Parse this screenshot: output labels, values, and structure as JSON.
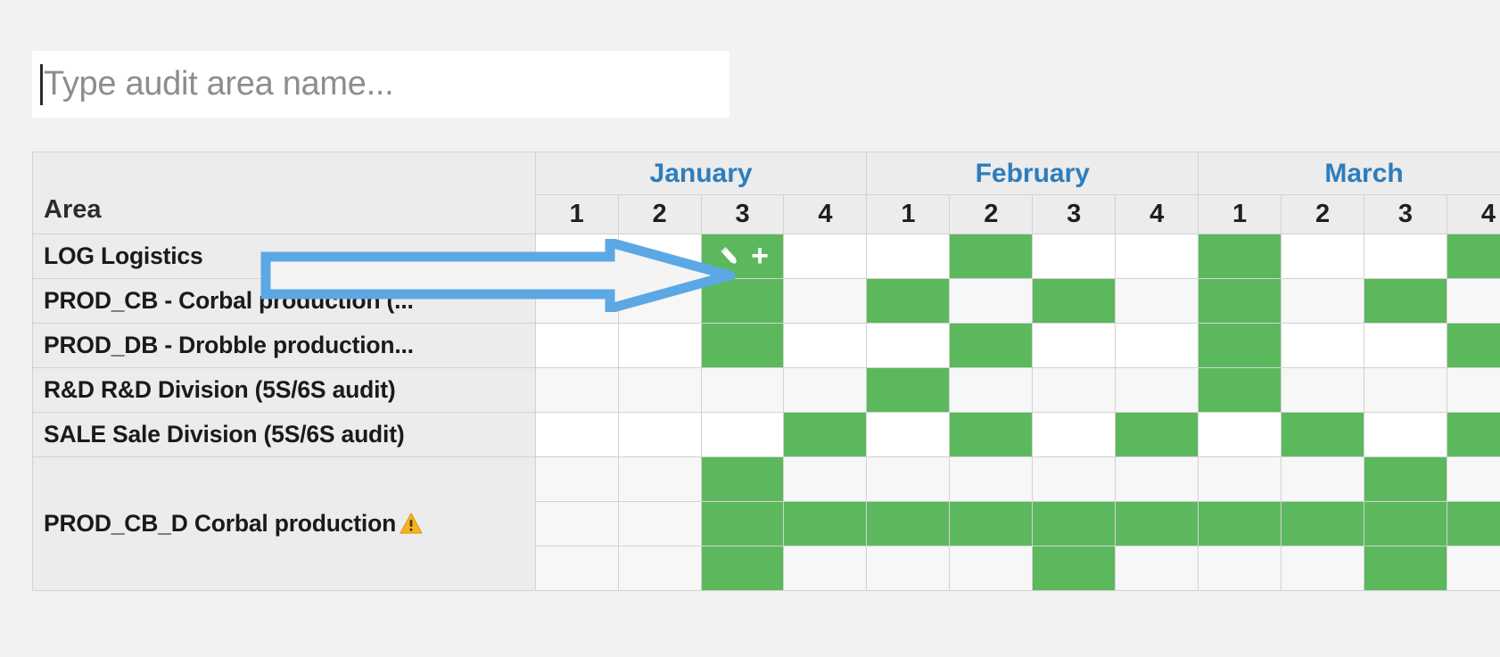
{
  "search": {
    "placeholder": "Type audit area name...",
    "value": ""
  },
  "colors": {
    "accent_green": "#5cb85c",
    "month_blue": "#2e7dbb",
    "arrow_blue": "#5ba8e5",
    "warning_amber": "#f5b324",
    "header_bg": "#ececec"
  },
  "table": {
    "area_header": "Area",
    "months": [
      {
        "name": "January",
        "weeks": [
          "1",
          "2",
          "3",
          "4"
        ]
      },
      {
        "name": "February",
        "weeks": [
          "1",
          "2",
          "3",
          "4"
        ]
      },
      {
        "name": "March",
        "weeks": [
          "1",
          "2",
          "3",
          "4"
        ]
      }
    ],
    "rows": [
      {
        "label": "LOG Logistics",
        "warning": false,
        "subrows": [
          {
            "cells": [
              0,
              0,
              1,
              0,
              0,
              1,
              0,
              0,
              1,
              0,
              0,
              1
            ],
            "icons_at": 2
          }
        ]
      },
      {
        "label": "PROD_CB - Corbal production (...",
        "warning": false,
        "subrows": [
          {
            "cells": [
              0,
              0,
              1,
              0,
              1,
              0,
              1,
              0,
              1,
              0,
              1,
              0
            ],
            "icons_at": -1
          }
        ]
      },
      {
        "label": "PROD_DB - Drobble production...",
        "warning": false,
        "subrows": [
          {
            "cells": [
              0,
              0,
              1,
              0,
              0,
              1,
              0,
              0,
              1,
              0,
              0,
              1
            ],
            "icons_at": -1
          }
        ]
      },
      {
        "label": "R&D R&D Division (5S/6S audit)",
        "warning": false,
        "subrows": [
          {
            "cells": [
              0,
              0,
              0,
              0,
              1,
              0,
              0,
              0,
              1,
              0,
              0,
              0
            ],
            "icons_at": -1
          }
        ]
      },
      {
        "label": "SALE Sale Division (5S/6S audit)",
        "warning": false,
        "subrows": [
          {
            "cells": [
              0,
              0,
              0,
              1,
              0,
              1,
              0,
              1,
              0,
              1,
              0,
              1
            ],
            "icons_at": -1
          }
        ]
      },
      {
        "label": "PROD_CB_D Corbal production",
        "warning": true,
        "subrows": [
          {
            "cells": [
              0,
              0,
              1,
              0,
              0,
              0,
              0,
              0,
              0,
              0,
              1,
              0
            ],
            "icons_at": -1
          },
          {
            "cells": [
              0,
              0,
              1,
              1,
              1,
              1,
              1,
              1,
              1,
              1,
              1,
              1
            ],
            "icons_at": -1
          },
          {
            "cells": [
              0,
              0,
              1,
              0,
              0,
              0,
              1,
              0,
              0,
              0,
              1,
              0
            ],
            "icons_at": -1
          }
        ]
      }
    ]
  },
  "icons": {
    "edit": "pencil-icon",
    "add": "plus-icon",
    "warning": "warning-triangle-icon",
    "cursor": "text-caret",
    "annotation": "right-arrow-annotation"
  },
  "annotation": {
    "arrow_label": "points to schedule cell January week 3 for LOG Logistics"
  }
}
